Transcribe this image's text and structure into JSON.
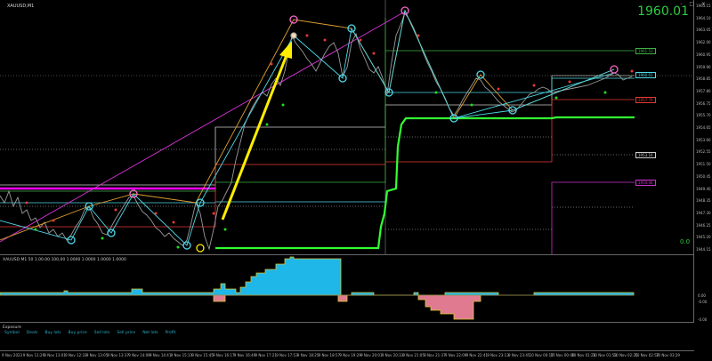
{
  "symbol_text": "XAUUSD,M1",
  "big_price": "1960.01",
  "zero_value": "0.0",
  "window_controls": "- □ ×",
  "indicator_label": "XAUUSD M1 50 1.00.00.100,00 1.0000 1.0000 1.0000 1.0000",
  "exposure": {
    "title": "Exposure",
    "columns": [
      "Symbol",
      "Deals",
      "Buy lots",
      "Buy price",
      "Sell lots",
      "Sell price",
      "Net lots",
      "Profit"
    ]
  },
  "price_axis": [
    "1965.15",
    "1964.10",
    "1963.05",
    "1962.00",
    "1960.95",
    "1959.90",
    "1958.85",
    "1957.80",
    "1956.75",
    "1955.70",
    "1954.65",
    "1953.60",
    "1952.55",
    "1951.50",
    "1950.45",
    "1949.40",
    "1948.35",
    "1947.30",
    "1946.25",
    "1945.20",
    "1944.15"
  ],
  "price_tags": [
    {
      "text": "1961.53",
      "color": "#3cb043"
    },
    {
      "text": "1960.01",
      "color": "#4fc3d9"
    },
    {
      "text": "1957.76",
      "color": "#e53935"
    },
    {
      "text": "1953.16",
      "color": "#cccccc"
    },
    {
      "text": "1950.46",
      "color": "#cc33cc"
    }
  ],
  "indicator_axis": [
    "0.00",
    "-0.00",
    "-0.00"
  ],
  "time_axis": [
    "9 Nov 2023",
    "9 Nov 11:29",
    "9 Nov 13:01",
    "9 Nov 12:33",
    "9 Nov 13:05",
    "9 Nov 13:37",
    "9 Nov 14:09",
    "9 Nov 14:41",
    "9 Nov 15:13",
    "9 Nov 15:45",
    "9 Nov 16:17",
    "9 Nov 16:49",
    "9 Nov 17:21",
    "9 Nov 17:53",
    "9 Nov 18:25",
    "9 Nov 18:57",
    "9 Nov 19:29",
    "9 Nov 20:01",
    "9 Nov 20:33",
    "9 Nov 21:05",
    "9 Nov 21:37",
    "9 Nov 22:09",
    "9 Nov 22:41",
    "9 Nov 23:13",
    "9 Nov 23:45",
    "10 Nov 00:17",
    "10 Nov 00:49",
    "10 Nov 01:21",
    "10 Nov 01:53",
    "10 Nov 02:25",
    "10 Nov 02:57",
    "10 Nov 03:29"
  ],
  "colors": {
    "background": "#000000",
    "candles": "#9a9a9a",
    "magenta": "#ff00ff",
    "cyan": "#4fd8e8",
    "green": "#22dd22",
    "bright_green": "#33ff33",
    "red": "#dd2222",
    "yellow": "#ffee00",
    "hist_blue": "#1fb6e8",
    "hist_pink": "#e07a90",
    "hist_outline": "#d9c830"
  }
}
